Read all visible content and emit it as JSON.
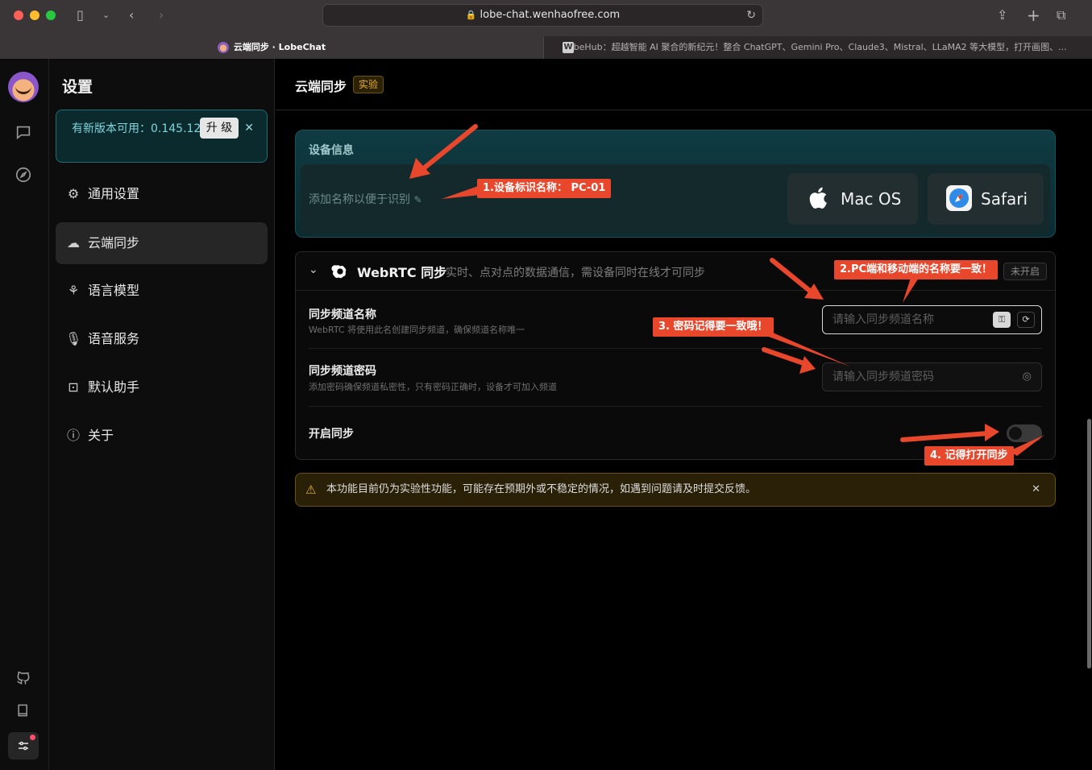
{
  "browser": {
    "url": "lobe-chat.wenhaofree.com",
    "active_tab": "云端同步 · LobeChat",
    "inactive_tab": "LobeHub：超越智能 AI 聚合的新纪元！整合 ChatGPT、Gemini Pro、Claude3、Mistral、LLaMA2 等大模型，打开画图、...",
    "inactive_tab_favicon": "W"
  },
  "sidebar": {
    "title": "设置",
    "update": {
      "text": "有新版本可用：0.145.12",
      "button": "升 级"
    },
    "items": [
      {
        "label": "通用设置",
        "icon": "sliders-icon"
      },
      {
        "label": "云端同步",
        "icon": "cloud-icon"
      },
      {
        "label": "语言模型",
        "icon": "webhook-icon"
      },
      {
        "label": "语音服务",
        "icon": "microphone-icon"
      },
      {
        "label": "默认助手",
        "icon": "robot-icon"
      },
      {
        "label": "关于",
        "icon": "info-icon"
      }
    ],
    "active_index": 1
  },
  "main": {
    "title": "云端同步",
    "tag": "实验",
    "device": {
      "title": "设备信息",
      "hint": "添加名称以便于识别",
      "os": "Mac OS",
      "browser": "Safari"
    },
    "webrtc": {
      "title": "WebRTC 同步",
      "description": "实时、点对点的数据通信，需设备同时在线才可同步",
      "status": "未开启",
      "channel_name": {
        "label": "同步频道名称",
        "desc": "WebRTC 将使用此名创建同步频道，确保频道名称唯一",
        "placeholder": "请输入同步频道名称"
      },
      "channel_password": {
        "label": "同步频道密码",
        "desc": "添加密码确保频道私密性，只有密码正确时，设备才可加入频道",
        "placeholder": "请输入同步频道密码"
      },
      "enable": {
        "label": "开启同步",
        "value": false
      }
    },
    "warning": "本功能目前仍为实验性功能，可能存在预期外或不稳定的情况，如遇到问题请及时提交反馈。"
  },
  "annotations": [
    "1.设备标识名称： PC-01",
    "2.PC端和移动端的名称要一致！",
    "3. 密码记得要一致哦！",
    "4. 记得打开同步"
  ],
  "colors": {
    "annotation": "#e8472c",
    "accent_teal": "#16525a",
    "warning": "#e8b32c"
  }
}
